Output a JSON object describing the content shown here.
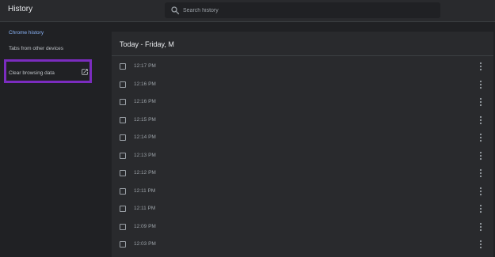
{
  "header": {
    "title": "History",
    "search_placeholder": "Search history"
  },
  "sidebar": {
    "items": [
      {
        "label": "Chrome history"
      },
      {
        "label": "Tabs from other devices"
      },
      {
        "label": "Clear browsing data"
      }
    ]
  },
  "main": {
    "day_header": "Today - Friday, M",
    "rows": [
      {
        "time": "12:17 PM"
      },
      {
        "time": "12:16 PM"
      },
      {
        "time": "12:16 PM"
      },
      {
        "time": "12:15 PM"
      },
      {
        "time": "12:14 PM"
      },
      {
        "time": "12:13 PM"
      },
      {
        "time": "12:12 PM"
      },
      {
        "time": "12:11 PM"
      },
      {
        "time": "12:11 PM"
      },
      {
        "time": "12:09 PM"
      },
      {
        "time": "12:03 PM"
      }
    ]
  },
  "colors": {
    "accent": "#8ab4f8",
    "highlight": "#7b2cbf"
  },
  "icons": [
    "search-icon",
    "external-link-icon",
    "more-vert-icon"
  ]
}
